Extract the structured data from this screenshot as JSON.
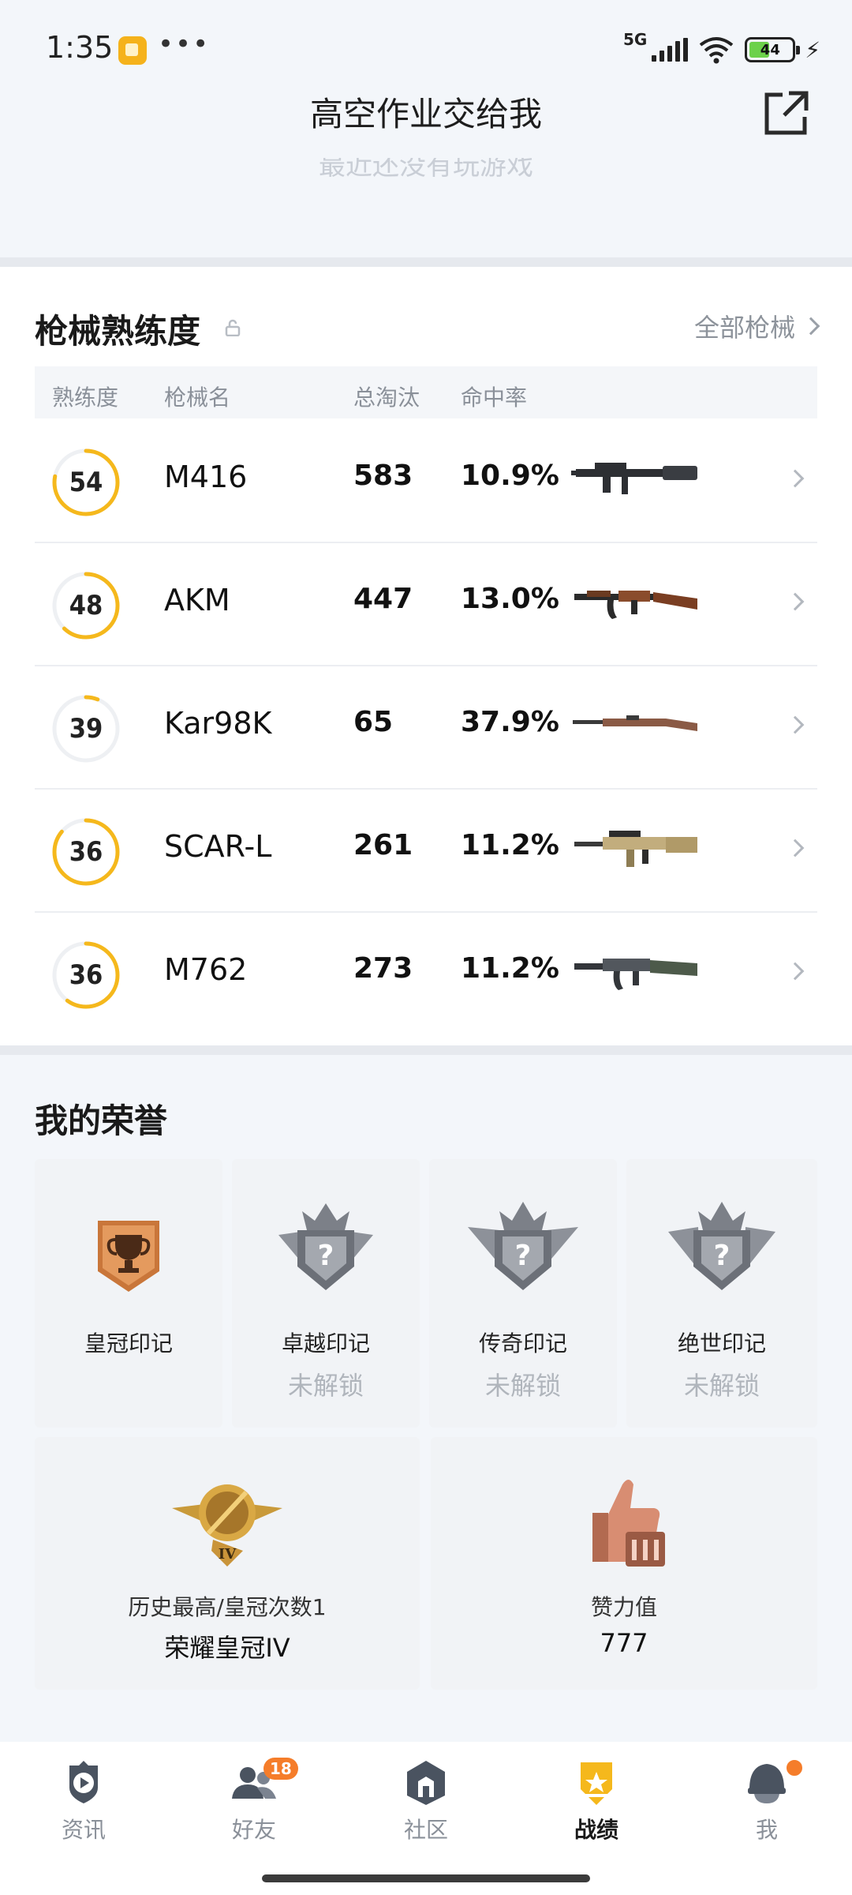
{
  "status": {
    "time": "1:35",
    "dots": "•••",
    "network": "5G",
    "battery": "44",
    "bolt": "⚡"
  },
  "header": {
    "title": "高空作业交给我",
    "ghost_text": "最近还没有玩游戏"
  },
  "weapons": {
    "title": "枪械熟练度",
    "all_link": "全部枪械",
    "columns": {
      "proficiency": "熟练度",
      "name": "枪械名",
      "kills": "总淘汰",
      "accuracy": "命中率"
    },
    "ring_color": "#f5b81c",
    "rows": [
      {
        "level": "54",
        "name": "M416",
        "kills": "583",
        "accuracy": "10.9%",
        "progress": 0.78,
        "gun": "m416"
      },
      {
        "level": "48",
        "name": "AKM",
        "kills": "447",
        "accuracy": "13.0%",
        "progress": 0.62,
        "gun": "akm"
      },
      {
        "level": "39",
        "name": "Kar98K",
        "kills": "65",
        "accuracy": "37.9%",
        "progress": 0.06,
        "gun": "kar98k"
      },
      {
        "level": "36",
        "name": "SCAR-L",
        "kills": "261",
        "accuracy": "11.2%",
        "progress": 0.86,
        "gun": "scar"
      },
      {
        "level": "36",
        "name": "M762",
        "kills": "273",
        "accuracy": "11.2%",
        "progress": 0.6,
        "gun": "m762"
      }
    ]
  },
  "honors": {
    "title": "我的荣誉",
    "marks": [
      {
        "name": "皇冠印记",
        "status": "",
        "icon": "trophy-icon"
      },
      {
        "name": "卓越印记",
        "status": "未解锁",
        "icon": "locked-crest-icon"
      },
      {
        "name": "传奇印记",
        "status": "未解锁",
        "icon": "locked-crest-icon"
      },
      {
        "name": "绝世印记",
        "status": "未解锁",
        "icon": "locked-crest-icon"
      }
    ],
    "rank": {
      "subtitle": "历史最高/皇冠次数1",
      "value": "荣耀皇冠IV",
      "roman": "IV"
    },
    "likes": {
      "subtitle": "赞力值",
      "value": "777"
    }
  },
  "nav": {
    "items": [
      {
        "label": "资讯",
        "icon": "news-icon"
      },
      {
        "label": "好友",
        "icon": "friends-icon",
        "badge": "18"
      },
      {
        "label": "社区",
        "icon": "community-icon"
      },
      {
        "label": "战绩",
        "icon": "record-icon",
        "active": true
      },
      {
        "label": "我",
        "icon": "profile-icon"
      }
    ]
  }
}
